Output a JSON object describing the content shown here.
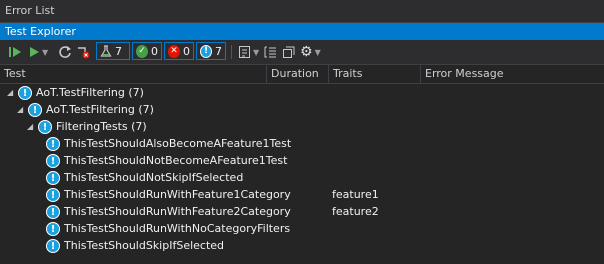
{
  "panels": {
    "error_list_title": "Error List",
    "test_explorer_title": "Test Explorer"
  },
  "toolbar": {
    "counts": {
      "total": "7",
      "passed": "0",
      "failed": "0",
      "skipped": "7"
    }
  },
  "columns": {
    "test": "Test",
    "duration": "Duration",
    "traits": "Traits",
    "error_message": "Error Message"
  },
  "tree": [
    {
      "label": "AoT.TestFiltering (7)",
      "level": 0,
      "expanded": true,
      "trait": ""
    },
    {
      "label": "AoT.TestFiltering (7)",
      "level": 1,
      "expanded": true,
      "trait": ""
    },
    {
      "label": "FilteringTests (7)",
      "level": 2,
      "expanded": true,
      "trait": ""
    },
    {
      "label": "ThisTestShouldAlsoBecomeAFeature1Test",
      "level": 3,
      "trait": ""
    },
    {
      "label": "ThisTestShouldNotBecomeAFeature1Test",
      "level": 3,
      "trait": ""
    },
    {
      "label": "ThisTestShouldNotSkipIfSelected",
      "level": 3,
      "trait": ""
    },
    {
      "label": "ThisTestShouldRunWithFeature1Category",
      "level": 3,
      "trait": "feature1"
    },
    {
      "label": "ThisTestShouldRunWithFeature2Category",
      "level": 3,
      "trait": "feature2"
    },
    {
      "label": "ThisTestShouldRunWithNoCategoryFilters",
      "level": 3,
      "trait": ""
    },
    {
      "label": "ThisTestShouldSkipIfSelected",
      "level": 3,
      "trait": ""
    }
  ],
  "colors": {
    "accent": "#007acc",
    "info": "#1ba1e2",
    "pass": "#43a047",
    "fail": "#e51400"
  }
}
